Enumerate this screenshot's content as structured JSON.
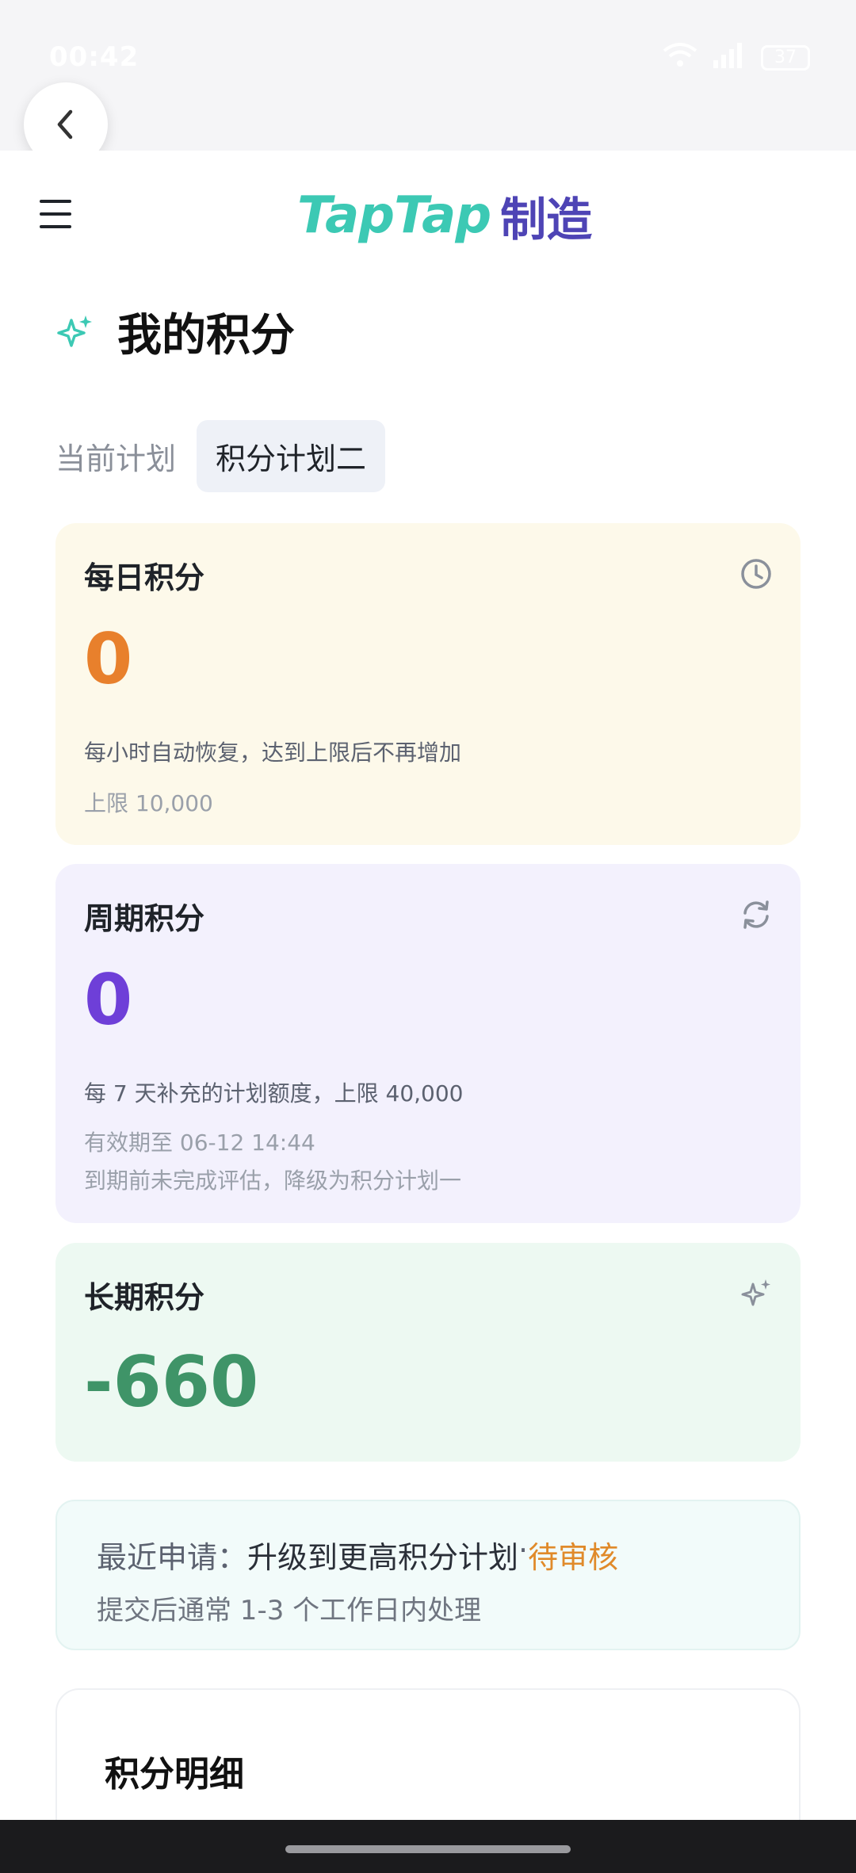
{
  "status_bar": {
    "time": "00:42",
    "battery": "37"
  },
  "header": {
    "logo_main": "TapTap",
    "logo_sub": "制造"
  },
  "page": {
    "title": "我的积分"
  },
  "plan": {
    "label": "当前计划",
    "current": "积分计划二"
  },
  "cards": {
    "daily": {
      "title": "每日积分",
      "value": "0",
      "desc": "每小时自动恢复，达到上限后不再增加",
      "limit": "上限 10,000",
      "color": "#e8802c",
      "icon": "clock-icon"
    },
    "period": {
      "title": "周期积分",
      "value": "0",
      "desc": "每 7 天补充的计划额度，上限 40,000",
      "expiry": "有效期至 06-12 14:44",
      "warning": "到期前未完成评估，降级为积分计划一",
      "color": "#6e3fd8",
      "icon": "refresh-icon"
    },
    "longterm": {
      "title": "长期积分",
      "value": "-660",
      "color": "#3f9468",
      "icon": "sparkle-icon"
    }
  },
  "notice": {
    "prefix": "最近申请：",
    "request": "升级到更高积分计划",
    "separator": " · ",
    "status": "待审核",
    "hint": "提交后通常 1-3 个工作日内处理"
  },
  "details": {
    "title": "积分明细"
  },
  "colors": {
    "brand_teal": "#3cc9b4",
    "brand_purple": "#4e44b5",
    "pending": "#e08a2a"
  }
}
